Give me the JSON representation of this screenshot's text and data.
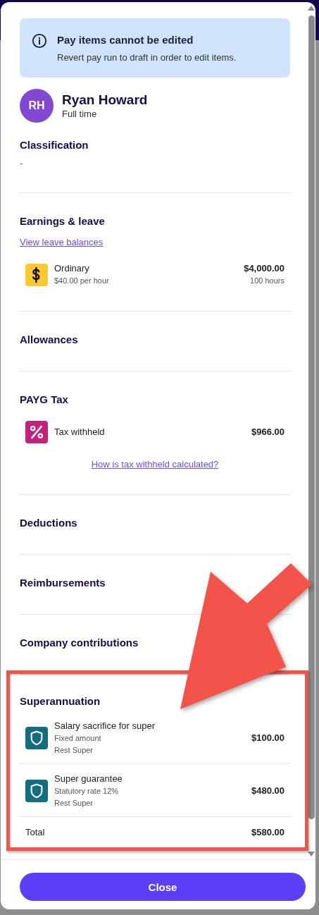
{
  "alert": {
    "title": "Pay items cannot be edited",
    "message": "Revert pay run to draft in order to edit items."
  },
  "employee": {
    "initials": "RH",
    "name": "Ryan Howard",
    "employment_type": "Full time"
  },
  "sections": [
    {
      "title": "Classification",
      "value": "-"
    },
    {
      "title": "Earnings & leave",
      "link": "View leave balances",
      "items": [
        {
          "kind": "earning",
          "name": "Ordinary",
          "details": [
            "$40.00 per hour"
          ],
          "amount": "$4,000.00",
          "sub_amount": "100 hours"
        }
      ]
    },
    {
      "title": "Allowances"
    },
    {
      "title": "PAYG Tax",
      "items": [
        {
          "kind": "tax",
          "name": "Tax withheld",
          "amount": "$966.00"
        }
      ],
      "footer_link": "How is tax withheld calculated?"
    },
    {
      "title": "Deductions"
    },
    {
      "title": "Reimbursements"
    },
    {
      "title": "Company contributions"
    },
    {
      "title": "Superannuation",
      "highlighted": true,
      "items": [
        {
          "kind": "super",
          "name": "Salary sacrifice for super",
          "details": [
            "Fixed amount",
            "Rest Super"
          ],
          "amount": "$100.00"
        },
        {
          "kind": "super",
          "name": "Super guarantee",
          "details": [
            "Statutory rate 12%",
            "Rest Super"
          ],
          "amount": "$480.00"
        }
      ],
      "total": {
        "label": "Total",
        "amount": "$580.00"
      }
    }
  ],
  "close_button": "Close"
}
